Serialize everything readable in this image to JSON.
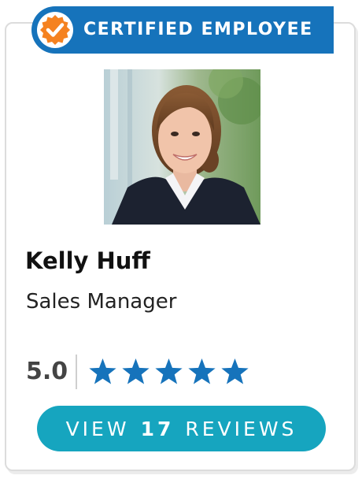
{
  "banner": {
    "label": "CERTIFIED EMPLOYEE",
    "badge_icon": "checkmark-seal-icon",
    "background_color": "#1673bb",
    "badge_color": "#f58220"
  },
  "employee": {
    "name": "Kelly Huff",
    "title": "Sales Manager",
    "photo_alt": "Kelly Huff"
  },
  "rating": {
    "value": "5.0",
    "stars": 5,
    "max_stars": 5,
    "star_color": "#1673bb"
  },
  "reviews_button": {
    "prefix": "VIEW",
    "count": "17",
    "suffix": "REVIEWS",
    "background_color": "#16a5bf"
  }
}
